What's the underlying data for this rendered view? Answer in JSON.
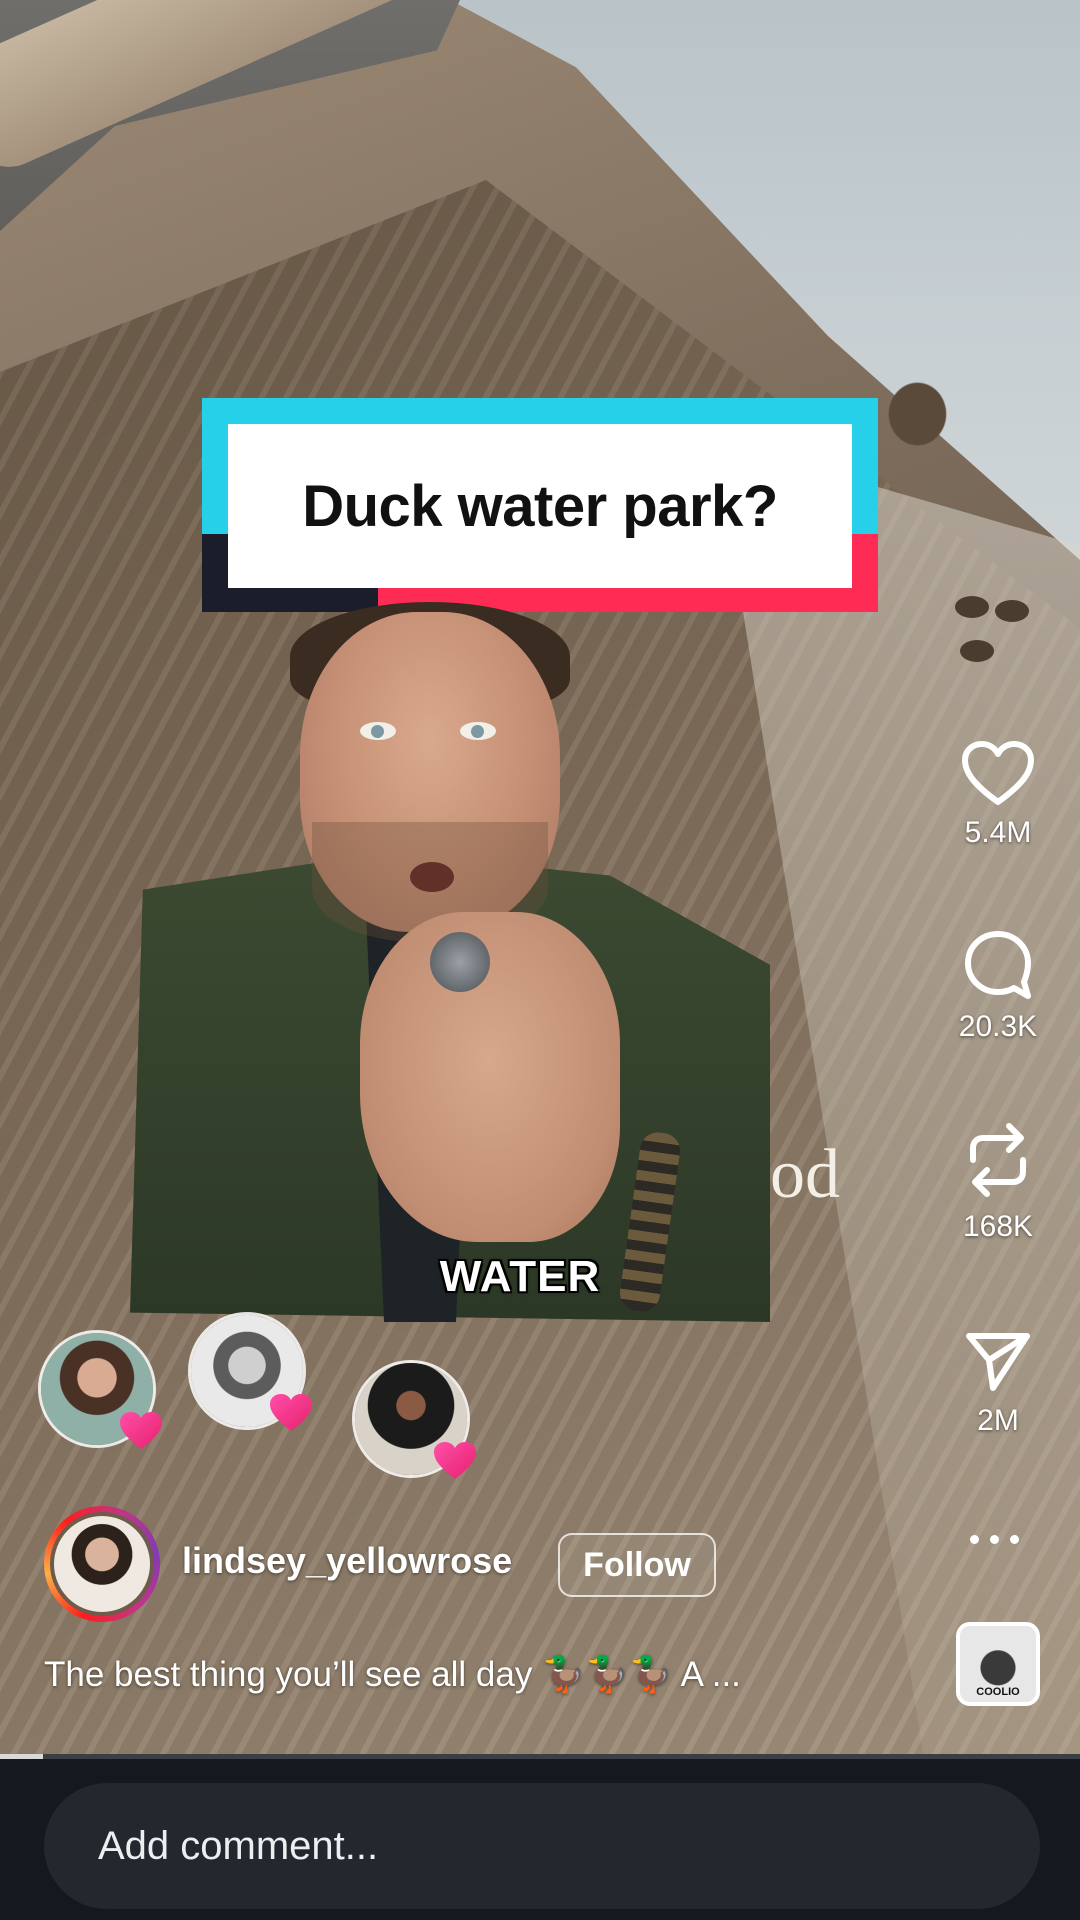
{
  "post": {
    "title_banner": "Duck water park?",
    "caption_word": "WATER",
    "background_text": "od",
    "author": "lindsey_yellowrose",
    "follow_label": "Follow",
    "description": "The best thing you’ll see all day 🦆🦆🦆 A ...",
    "playback_progress": 0.04
  },
  "actions": {
    "like_count": "5.4M",
    "comment_count": "20.3K",
    "repost_count": "168K",
    "share_count": "2M"
  },
  "audio": {
    "thumb_text": "COOLIO"
  },
  "likers": [
    {
      "icon": "heart-badge"
    },
    {
      "icon": "heart-badge"
    },
    {
      "icon": "heart-badge"
    }
  ],
  "comment_bar": {
    "placeholder": "Add comment..."
  },
  "colors": {
    "banner_cyan": "#25d0e8",
    "banner_red": "#fe2c55",
    "banner_dark": "#1c1d2b",
    "comment_bar_bg": "#15191f"
  }
}
